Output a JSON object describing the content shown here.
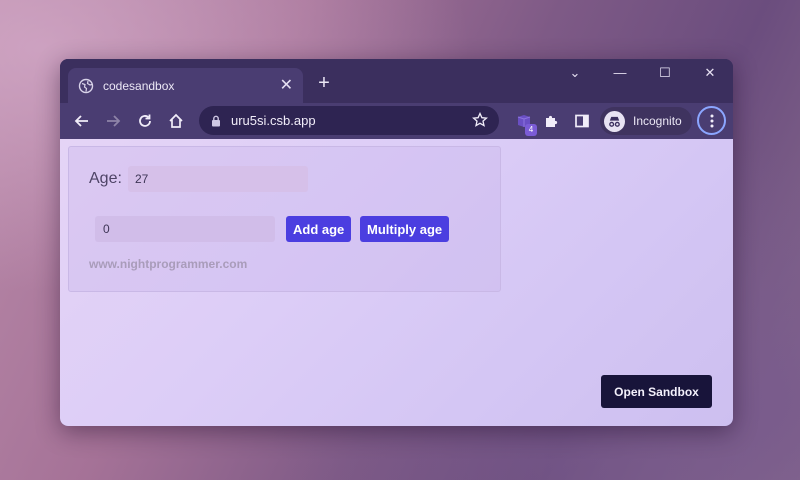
{
  "browser": {
    "tab": {
      "title": "codesandbox",
      "close_glyph": "✕",
      "icon": "globe-icon"
    },
    "new_tab_glyph": "+",
    "window_controls": {
      "dropdown": "⌄",
      "minimize": "—",
      "maximize": "☐",
      "close": "✕"
    },
    "address": {
      "url": "uru5si.csb.app"
    },
    "extensions_badge": "4",
    "profile": {
      "label": "Incognito"
    },
    "colors": {
      "frame": "#3b2f5e",
      "toolbar": "#4a3d72",
      "omnibox": "#2e2452"
    }
  },
  "page": {
    "age": {
      "label": "Age:",
      "value": "27"
    },
    "amount": {
      "value": "0"
    },
    "buttons": {
      "add": "Add age",
      "multiply": "Multiply age"
    },
    "footer_link": "www.nightprogrammer.com",
    "open_sandbox": "Open Sandbox",
    "colors": {
      "accent": "#4b3ee0",
      "sandbox_button": "#18143a"
    }
  }
}
